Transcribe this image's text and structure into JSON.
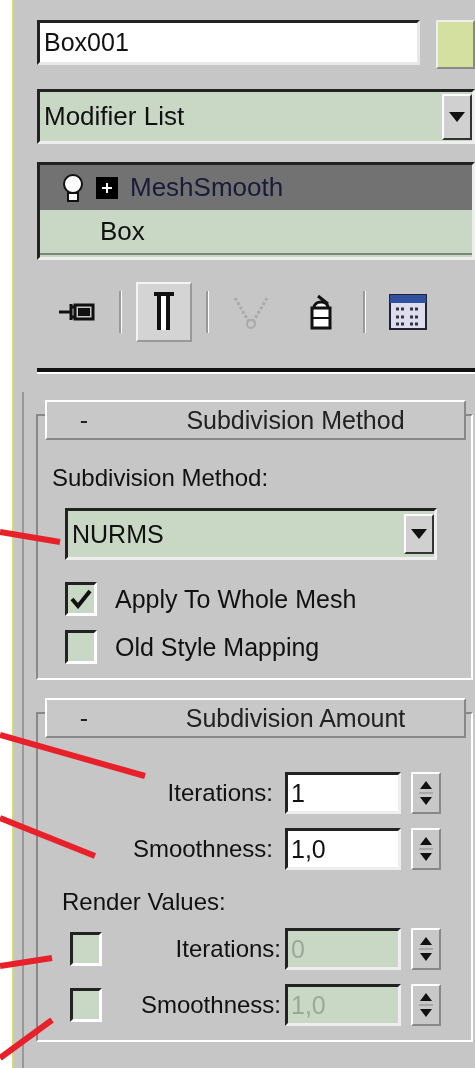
{
  "object_name": {
    "value": "Box001"
  },
  "modifier_list": {
    "value": "Modifier List"
  },
  "stack": [
    {
      "label": "MeshSmooth",
      "selected": true,
      "kind": "modifier"
    },
    {
      "label": "Box",
      "selected": false,
      "kind": "base"
    }
  ],
  "toolbar": [
    {
      "kind": "pin",
      "pressed": false
    },
    {
      "kind": "separator"
    },
    {
      "kind": "end-result",
      "pressed": true
    },
    {
      "kind": "separator"
    },
    {
      "kind": "unique",
      "pressed": false
    },
    {
      "kind": "remove",
      "pressed": false
    },
    {
      "kind": "separator"
    },
    {
      "kind": "configure",
      "pressed": false
    }
  ],
  "subdivision_method": {
    "sign": "-",
    "title": "Subdivision Method",
    "method_label": "Subdivision Method:",
    "method_dropdown": {
      "value": "NURMS"
    },
    "checkboxes": [
      {
        "label": "Apply To Whole Mesh",
        "checked": true
      },
      {
        "label": "Old Style Mapping",
        "checked": false
      }
    ]
  },
  "subdivision_amount": {
    "sign": "-",
    "title": "Subdivision Amount",
    "spinners": [
      {
        "label": "Iterations:",
        "value": "1",
        "disabled": false
      },
      {
        "label": "Smoothness:",
        "value": "1,0",
        "disabled": false
      }
    ],
    "render_label": "Render Values:",
    "render_spinners": [
      {
        "label": "Iterations:",
        "value": "0",
        "checked": false,
        "disabled": true
      },
      {
        "label": "Smoothness:",
        "value": "1,0",
        "checked": false,
        "disabled": true
      }
    ]
  }
}
